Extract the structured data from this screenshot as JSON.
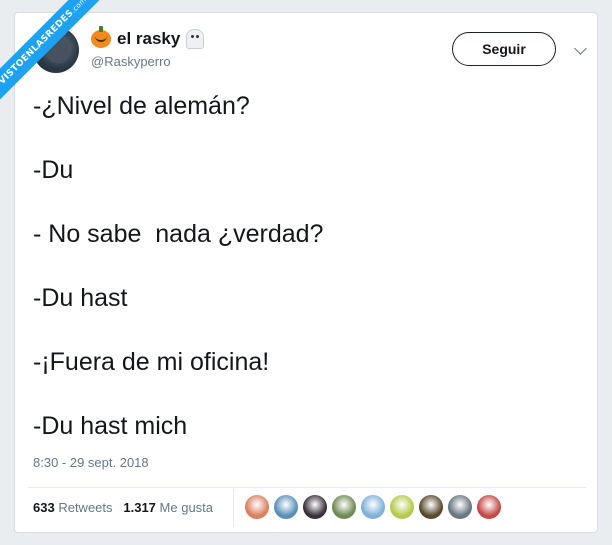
{
  "watermark": {
    "text": "VISTOENLASREDES",
    "suffix": ".com"
  },
  "tweet": {
    "author": {
      "name": "el rasky",
      "handle": "@Raskyperro",
      "emoji_before": "pumpkin-emoji",
      "emoji_after": "ghost-emoji"
    },
    "follow_label": "Seguir",
    "lines": [
      "-¿Nivel de alemán?",
      "-Du",
      "- No sabe  nada ¿verdad?",
      "-Du hast",
      "-¡Fuera de mi oficina!",
      "-Du hast mich"
    ],
    "timestamp": "8:30 - 29 sept. 2018",
    "stats": {
      "retweets_count": "633",
      "retweets_label": "Retweets",
      "likes_count": "1.317",
      "likes_label": "Me gusta"
    },
    "liker_avatars": [
      "#d9805f",
      "#5b8fb9",
      "#3a2f3a",
      "#6f8a55",
      "#7fb0d8",
      "#b5c94a",
      "#5a4a2e",
      "#6a7680",
      "#c44a4a"
    ]
  },
  "colors": {
    "accent": "#1da1f2",
    "text": "#14171a",
    "muted": "#657786",
    "border": "#e6ecf0"
  }
}
